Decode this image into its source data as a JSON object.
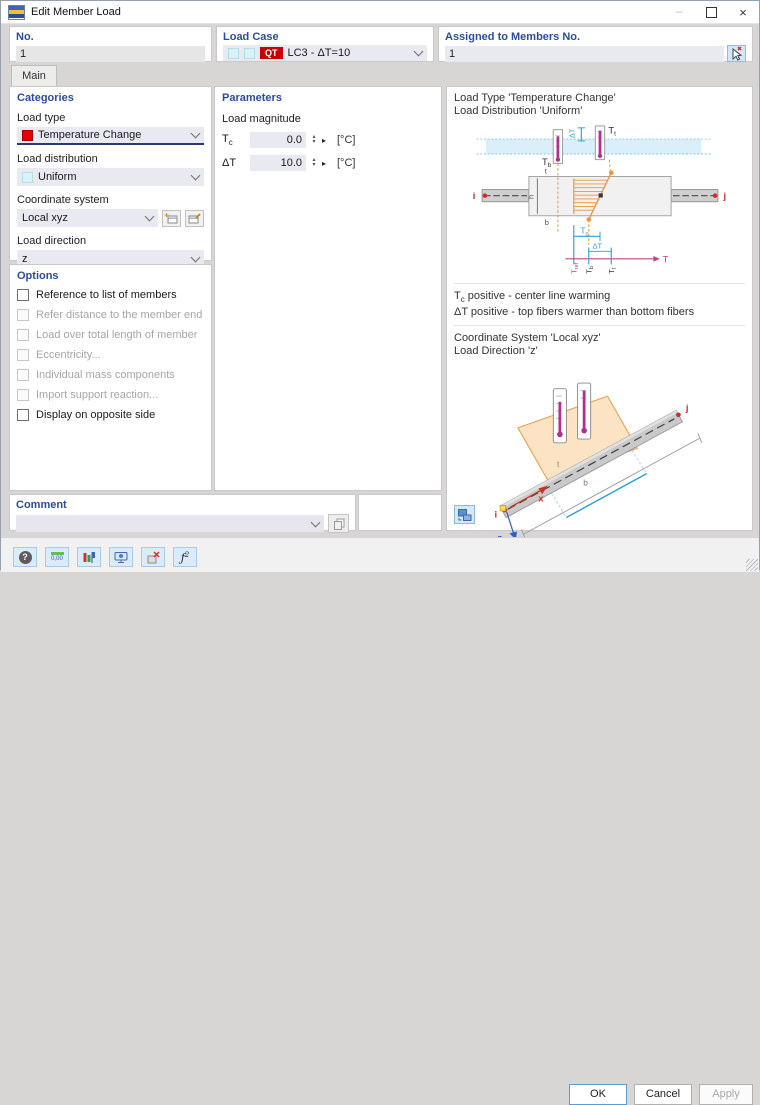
{
  "window": {
    "title": "Edit Member Load",
    "minimize_glyph": "–",
    "close_glyph": "×"
  },
  "top": {
    "no_label": "No.",
    "no_value": "1",
    "load_case_label": "Load Case",
    "load_case_badge": "QT",
    "load_case_value": "LC3 - ΔT=10",
    "assigned_label": "Assigned to Members No.",
    "assigned_value": "1"
  },
  "tabs": {
    "main": "Main"
  },
  "categories": {
    "title": "Categories",
    "load_type_label": "Load type",
    "load_type_value": "Temperature Change",
    "load_dist_label": "Load distribution",
    "load_dist_value": "Uniform",
    "coord_label": "Coordinate system",
    "coord_value": "Local xyz",
    "dir_label": "Load direction",
    "dir_value": "z"
  },
  "parameters": {
    "title": "Parameters",
    "subtitle": "Load magnitude",
    "tc_label_main": "T",
    "tc_label_sub": "c",
    "tc_value": "0.0",
    "tc_unit": "[°C]",
    "dt_label": "ΔT",
    "dt_value": "10.0",
    "dt_unit": "[°C]"
  },
  "options": {
    "title": "Options",
    "items": [
      {
        "label": "Reference to list of members",
        "enabled": true,
        "checked": false
      },
      {
        "label": "Refer distance to the member end",
        "enabled": false,
        "checked": false
      },
      {
        "label": "Load over total length of member",
        "enabled": false,
        "checked": false
      },
      {
        "label": "Eccentricity...",
        "enabled": false,
        "checked": false
      },
      {
        "label": "Individual mass components",
        "enabled": false,
        "checked": false
      },
      {
        "label": "Import support reaction...",
        "enabled": false,
        "checked": false
      },
      {
        "label": "Display on opposite side",
        "enabled": true,
        "checked": false
      }
    ]
  },
  "comment": {
    "title": "Comment",
    "value": ""
  },
  "info": {
    "line1": "Load Type 'Temperature Change'",
    "line2": "Load Distribution 'Uniform'",
    "note1_main": "T",
    "note1_sub": "c",
    "note1_rest": " positive - center line warming",
    "note2": "ΔT positive - top fibers warmer than bottom fibers",
    "cs_line1": "Coordinate System 'Local xyz'",
    "cs_line2": "Load Direction 'z'"
  },
  "diagram1": {
    "labels": {
      "dt_dim": "ΔT",
      "tt_main": "T",
      "tt_sub": "t",
      "tb_main": "T",
      "tb_sub": "b",
      "node_i": "i",
      "node_j": "j",
      "t": "t",
      "h": "h",
      "b": "b",
      "tc_main": "T",
      "tc_sub": "c",
      "dt_axis": "ΔT",
      "axis_t": "T",
      "tref_main": "T",
      "tref_sub": "ref",
      "tb2_main": "T",
      "tb2_sub": "b",
      "tt2_main": "T",
      "tt2_sub": "t"
    }
  },
  "diagram2": {
    "labels": {
      "node_i": "i",
      "node_j": "j",
      "t": "t",
      "b": "b",
      "axis_x": "x",
      "axis_z": "z"
    }
  },
  "toolbar": {
    "help_glyph": "?",
    "decimal_text": "0,00",
    "formula_text": "ƒ"
  },
  "footer": {
    "ok": "OK",
    "cancel": "Cancel",
    "apply": "Apply"
  },
  "colors": {
    "header_blue": "#2b4d9e",
    "badge_red": "#c60006",
    "swatch_red": "#e60000",
    "swatch_cyan": "#d8f2f7"
  }
}
